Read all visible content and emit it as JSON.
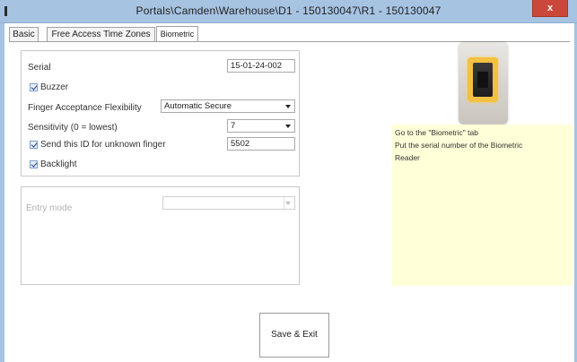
{
  "window": {
    "title": "Portals\\Camden\\Warehouse\\D1 - 150130047\\R1 - 150130047",
    "close_label": "x"
  },
  "tabs": [
    {
      "label": "Basic",
      "active": false
    },
    {
      "label": "Free Access Time Zones",
      "active": false
    },
    {
      "label": "Biometric",
      "active": true
    }
  ],
  "biometric": {
    "serial_label": "Serial",
    "serial_value": "15-01-24-002",
    "buzzer_label": "Buzzer",
    "buzzer_checked": true,
    "finger_flex_label": "Finger Acceptance Flexibility",
    "finger_flex_value": "Automatic Secure",
    "sensitivity_label": "Sensitivity (0 = lowest)",
    "sensitivity_value": "7",
    "send_id_label": "Send this ID for unknown finger",
    "send_id_checked": true,
    "send_id_value": "5502",
    "backlight_label": "Backlight",
    "backlight_checked": true
  },
  "entry": {
    "label": "Entry mode",
    "value": ""
  },
  "note": {
    "lines": [
      "Go to the \"Biometric\" tab",
      "Put the serial number of the Biometric",
      "Reader"
    ]
  },
  "actions": {
    "save_label": "Save & Exit"
  },
  "colors": {
    "titlebar": "#a7c3e2",
    "close_button": "#c9483b",
    "note_background": "#ffffd8",
    "device_ring": "#f3c142"
  },
  "icons": {
    "checkbox_mark": "check-icon",
    "dropdown": "chevron-down-icon"
  }
}
